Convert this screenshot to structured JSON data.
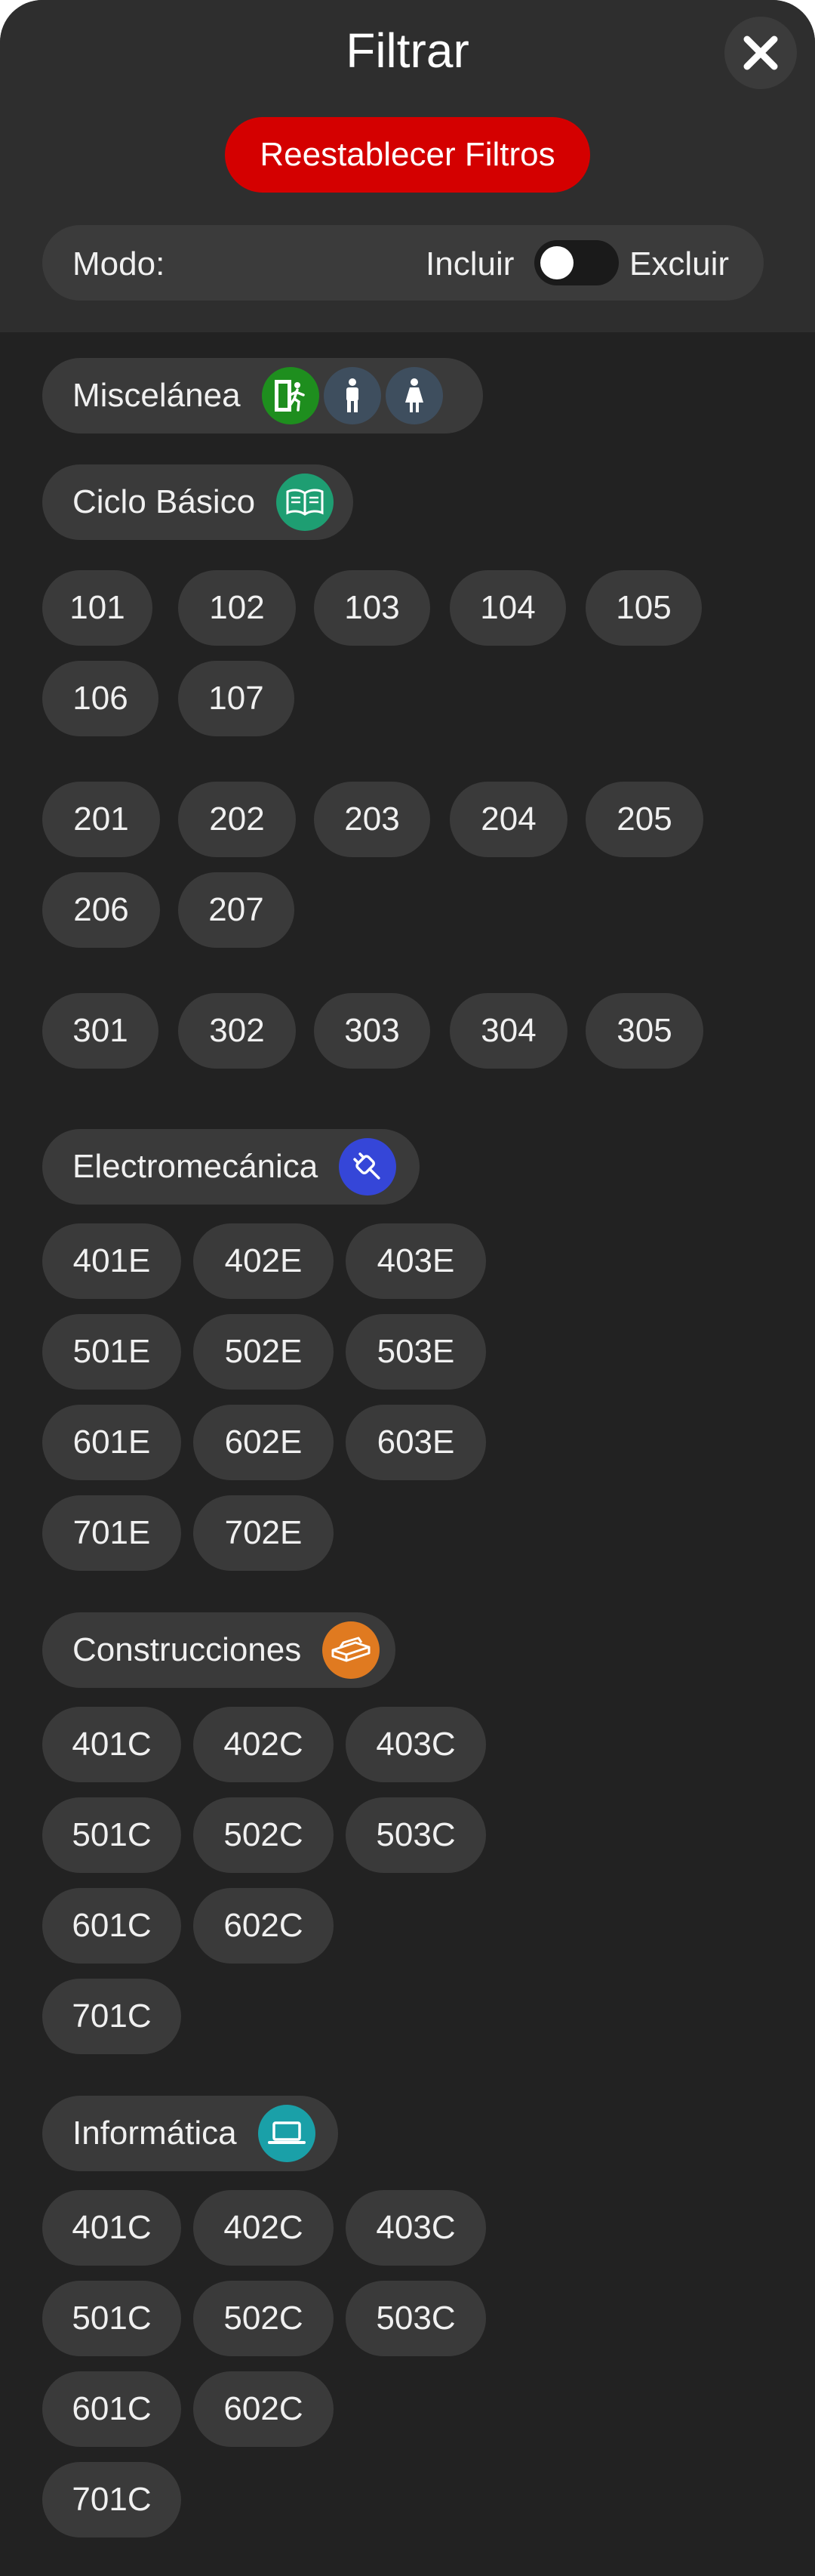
{
  "header": {
    "title": "Filtrar",
    "reset_label": "Reestablecer Filtros",
    "mode_label": "Modo:",
    "include_label": "Incluir",
    "exclude_label": "Excluir",
    "toggle_state": "Incluir"
  },
  "colors": {
    "background": "#222222",
    "chip": "#3a3a3a",
    "reset": "#d40000",
    "misc_exit": "#1e8e1e",
    "misc_restroom": "#3e4e5e",
    "ciclo": "#1e9e72",
    "electro": "#3546d8",
    "construcciones": "#e07a20",
    "informatica": "#1aa0a8"
  },
  "categories": {
    "miscelanea": {
      "label": "Miscelánea",
      "icons": [
        "emergency-exit-icon",
        "mens-restroom-icon",
        "womens-restroom-icon"
      ]
    },
    "ciclo": {
      "label": "Ciclo Básico",
      "icon": "open-book-icon",
      "rooms": [
        "101",
        "102",
        "103",
        "104",
        "105",
        "106",
        "107",
        "201",
        "202",
        "203",
        "204",
        "205",
        "206",
        "207",
        "301",
        "302",
        "303",
        "304",
        "305"
      ]
    },
    "electro": {
      "label": "Electromecánica",
      "icon": "plug-icon",
      "rooms": [
        "401E",
        "402E",
        "403E",
        "501E",
        "502E",
        "503E",
        "601E",
        "602E",
        "603E",
        "701E",
        "702E"
      ]
    },
    "construcciones": {
      "label": "Construcciones",
      "icon": "bricks-icon",
      "rooms": [
        "401C",
        "402C",
        "403C",
        "501C",
        "502C",
        "503C",
        "601C",
        "602C",
        "701C"
      ]
    },
    "informatica": {
      "label": "Informática",
      "icon": "laptop-icon",
      "rooms": [
        "401C",
        "402C",
        "403C",
        "501C",
        "502C",
        "503C",
        "601C",
        "602C",
        "701C"
      ]
    }
  }
}
